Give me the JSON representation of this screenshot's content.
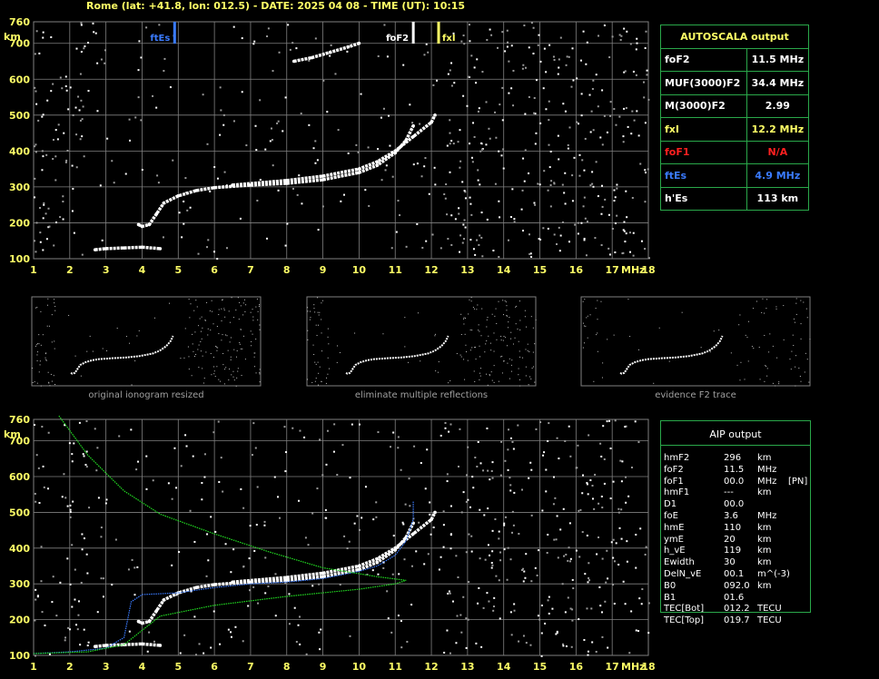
{
  "header": "Rome (lat: +41.8, lon: 012.5) - DATE: 2025 04 08 - TIME (UT): 10:15",
  "colors": {
    "grid": "#808080",
    "green": "#2aa84a",
    "yellow": "#ffff66",
    "blue": "#3a7bff",
    "red": "#ff2020",
    "trace": "#ffffff"
  },
  "autoscala": {
    "title": "AUTOSCALA output",
    "rows": [
      {
        "label": "foF2",
        "value": "11.5 MHz",
        "color": "#ffffff"
      },
      {
        "label": "MUF(3000)F2",
        "value": "34.4 MHz",
        "color": "#ffffff"
      },
      {
        "label": "M(3000)F2",
        "value": "2.99",
        "color": "#ffffff"
      },
      {
        "label": "fxI",
        "value": "12.2 MHz",
        "color": "#ffff66"
      },
      {
        "label": "foF1",
        "value": "N/A",
        "color": "#ff2020"
      },
      {
        "label": "ftEs",
        "value": "4.9 MHz",
        "color": "#3a7bff"
      },
      {
        "label": "h'Es",
        "value": "113     km",
        "color": "#ffffff"
      }
    ]
  },
  "thumbnails": [
    {
      "caption": "original ionogram resized"
    },
    {
      "caption": "eliminate multiple reflections"
    },
    {
      "caption": "evidence F2 trace"
    }
  ],
  "aip": {
    "title": "AIP output",
    "rows": [
      [
        "hmF2",
        "296",
        "km",
        ""
      ],
      [
        "foF2",
        "11.5",
        "MHz",
        ""
      ],
      [
        "foF1",
        "00.0",
        "MHz",
        "[PN]"
      ],
      [
        "hmF1",
        "---",
        "km",
        ""
      ],
      [
        "D1",
        "00.0",
        "",
        ""
      ],
      [
        "foE",
        "3.6",
        "MHz",
        ""
      ],
      [
        "hmE",
        "110",
        "km",
        ""
      ],
      [
        "ymE",
        "20",
        "km",
        ""
      ],
      [
        "h_vE",
        "119",
        "km",
        ""
      ],
      [
        "Ewidth",
        "30",
        "km",
        ""
      ],
      [
        "DelN_vE",
        "00.1",
        "m^(-3)",
        ""
      ],
      [
        "B0",
        "092.0",
        "km",
        ""
      ],
      [
        "B1",
        "01.6",
        "",
        ""
      ],
      [
        "TEC[Bot]",
        "012.2",
        "TECU",
        ""
      ],
      [
        "TEC[Top]",
        "019.7",
        "TECU",
        ""
      ]
    ]
  },
  "chart_data": [
    {
      "type": "scatter",
      "title": "",
      "xlabel": "MHz",
      "ylabel": "km",
      "xlim": [
        1,
        18
      ],
      "ylim": [
        100,
        760
      ],
      "x_ticks": [
        1,
        2,
        3,
        4,
        5,
        6,
        7,
        8,
        9,
        10,
        11,
        12,
        13,
        14,
        15,
        16,
        17,
        18
      ],
      "y_ticks": [
        100,
        200,
        300,
        400,
        500,
        600,
        700,
        760
      ],
      "grid": true,
      "markers": [
        {
          "name": "ftEs",
          "x": 4.9,
          "color": "#3a7bff"
        },
        {
          "name": "foF2",
          "x": 11.5,
          "color": "#ffffff"
        },
        {
          "name": "fxI",
          "x": 12.2,
          "color": "#ffff66"
        }
      ],
      "series": [
        {
          "color": "#ffffff",
          "points": [
            [
              3.9,
              195
            ],
            [
              4.0,
              190
            ],
            [
              4.2,
              195
            ],
            [
              4.4,
              225
            ],
            [
              4.6,
              255
            ],
            [
              5.0,
              275
            ],
            [
              5.5,
              290
            ],
            [
              6.0,
              298
            ],
            [
              7.0,
              305
            ],
            [
              8.0,
              310
            ],
            [
              9.0,
              320
            ],
            [
              10.0,
              340
            ],
            [
              10.5,
              360
            ],
            [
              11.0,
              395
            ],
            [
              11.3,
              430
            ],
            [
              11.5,
              470
            ]
          ]
        },
        {
          "color": "#ffffff",
          "points": [
            [
              6.5,
              305
            ],
            [
              8.0,
              318
            ],
            [
              9.0,
              330
            ],
            [
              10.0,
              350
            ],
            [
              10.5,
              370
            ],
            [
              11.0,
              400
            ],
            [
              11.5,
              440
            ],
            [
              12.0,
              480
            ],
            [
              12.1,
              500
            ]
          ]
        },
        {
          "color": "#ffffff",
          "points": [
            [
              2.7,
              125
            ],
            [
              3.0,
              128
            ],
            [
              3.5,
              130
            ],
            [
              4.0,
              132
            ],
            [
              4.5,
              128
            ]
          ]
        },
        {
          "color": "#ffffff",
          "points": [
            [
              8.2,
              650
            ],
            [
              8.7,
              660
            ],
            [
              9.2,
              675
            ],
            [
              9.7,
              690
            ],
            [
              10.0,
              700
            ]
          ]
        }
      ]
    },
    {
      "type": "scatter",
      "title": "",
      "xlabel": "MHz",
      "ylabel": "km",
      "xlim": [
        1,
        18
      ],
      "ylim": [
        100,
        760
      ],
      "x_ticks": [
        1,
        2,
        3,
        4,
        5,
        6,
        7,
        8,
        9,
        10,
        11,
        12,
        13,
        14,
        15,
        16,
        17,
        18
      ],
      "y_ticks": [
        100,
        200,
        300,
        400,
        500,
        600,
        700,
        760
      ],
      "grid": true,
      "series": [
        {
          "color": "#ffffff",
          "points": [
            [
              3.9,
              195
            ],
            [
              4.0,
              190
            ],
            [
              4.2,
              195
            ],
            [
              4.4,
              225
            ],
            [
              4.6,
              255
            ],
            [
              5.0,
              275
            ],
            [
              5.5,
              290
            ],
            [
              6.0,
              298
            ],
            [
              7.0,
              305
            ],
            [
              8.0,
              310
            ],
            [
              9.0,
              320
            ],
            [
              10.0,
              340
            ],
            [
              10.5,
              360
            ],
            [
              11.0,
              395
            ],
            [
              11.3,
              430
            ],
            [
              11.5,
              470
            ]
          ]
        },
        {
          "color": "#ffffff",
          "points": [
            [
              6.5,
              305
            ],
            [
              8.0,
              318
            ],
            [
              9.0,
              330
            ],
            [
              10.0,
              350
            ],
            [
              10.5,
              370
            ],
            [
              11.0,
              400
            ],
            [
              11.5,
              440
            ],
            [
              12.0,
              480
            ],
            [
              12.1,
              500
            ]
          ]
        },
        {
          "color": "#ffffff",
          "points": [
            [
              2.7,
              125
            ],
            [
              3.0,
              128
            ],
            [
              3.5,
              130
            ],
            [
              4.0,
              132
            ],
            [
              4.5,
              128
            ]
          ]
        },
        {
          "color": "#3a7bff",
          "points": [
            [
              1.0,
              105
            ],
            [
              2.0,
              110
            ],
            [
              3.0,
              120
            ],
            [
              3.5,
              150
            ],
            [
              3.7,
              250
            ],
            [
              4.0,
              270
            ],
            [
              5.0,
              275
            ],
            [
              6.0,
              290
            ],
            [
              7.0,
              300
            ],
            [
              8.0,
              305
            ],
            [
              9.0,
              315
            ],
            [
              10.0,
              335
            ],
            [
              10.5,
              350
            ],
            [
              11.0,
              380
            ],
            [
              11.3,
              420
            ],
            [
              11.5,
              480
            ],
            [
              11.5,
              530
            ]
          ]
        },
        {
          "color": "#22dd22",
          "points": [
            [
              1.7,
              770
            ],
            [
              2.5,
              660
            ],
            [
              3.5,
              560
            ],
            [
              4.5,
              495
            ],
            [
              6.0,
              440
            ],
            [
              7.5,
              390
            ],
            [
              9.0,
              345
            ],
            [
              10.5,
              320
            ],
            [
              11.3,
              310
            ],
            [
              11.0,
              300
            ],
            [
              10.0,
              285
            ],
            [
              8.0,
              265
            ],
            [
              6.0,
              240
            ],
            [
              4.5,
              210
            ],
            [
              4.0,
              170
            ],
            [
              3.5,
              130
            ],
            [
              2.5,
              110
            ],
            [
              1.0,
              105
            ]
          ]
        }
      ]
    }
  ]
}
